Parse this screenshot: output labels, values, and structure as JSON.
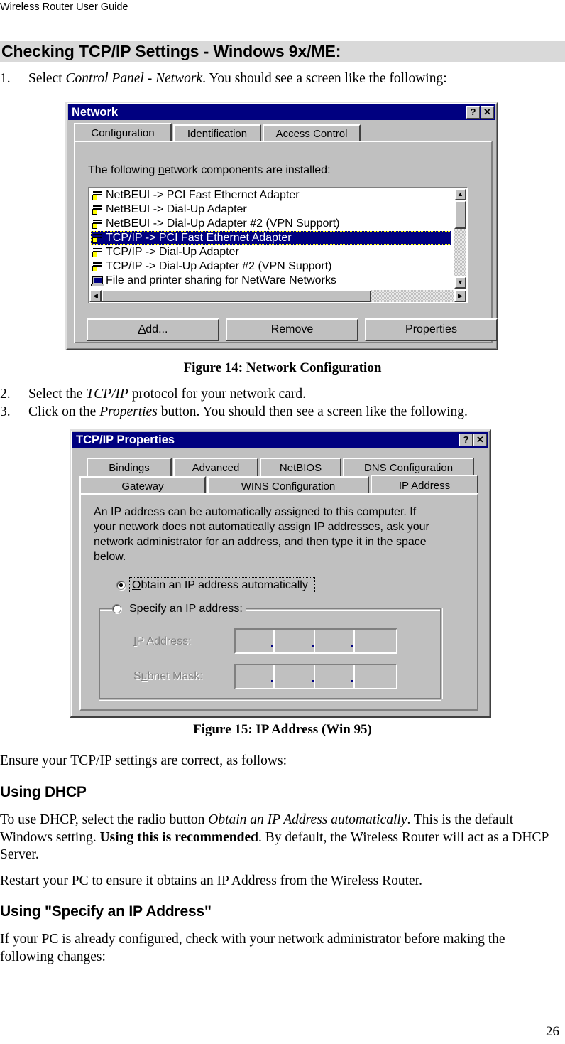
{
  "document": {
    "running_header": "Wireless Router User Guide",
    "page_number": "26",
    "heading1": "Checking TCP/IP Settings - Windows 9x/ME:",
    "steps": [
      {
        "num": "1.",
        "parts": [
          {
            "t": "Select ",
            "s": "n"
          },
          {
            "t": "Control Panel - Network",
            "s": "i"
          },
          {
            "t": ". You should see a screen like the following:",
            "s": "n"
          }
        ]
      },
      {
        "num": "2.",
        "parts": [
          {
            "t": "Select the ",
            "s": "n"
          },
          {
            "t": "TCP/IP",
            "s": "i"
          },
          {
            "t": " protocol for your network card.",
            "s": "n"
          }
        ]
      },
      {
        "num": "3.",
        "parts": [
          {
            "t": "Click on the ",
            "s": "n"
          },
          {
            "t": "Properties",
            "s": "i"
          },
          {
            "t": " button. You should then see a screen like the following.",
            "s": "n"
          }
        ]
      }
    ],
    "figure14_caption": "Figure 14: Network Configuration",
    "figure15_caption": "Figure 15: IP Address (Win 95)",
    "intro_para": "Ensure your TCP/IP settings are correct, as follows:",
    "heading_dhcp": "Using DHCP",
    "dhcp_para_parts": [
      {
        "t": "To use DHCP, select the radio button ",
        "s": "n"
      },
      {
        "t": "Obtain an IP Address automatically",
        "s": "i"
      },
      {
        "t": ". This is the default Windows setting. ",
        "s": "n"
      },
      {
        "t": "Using this is recommended",
        "s": "b"
      },
      {
        "t": ". By default, the Wireless Router will act as a DHCP Server.",
        "s": "n"
      }
    ],
    "restart_para": "Restart your PC to ensure it obtains an IP Address from the Wireless Router.",
    "heading_specify": "Using \"Specify an IP Address\"",
    "specify_para": "If your PC is already configured, check with your network administrator before making the following changes:"
  },
  "figure14": {
    "window_title": "Network",
    "titlebar_buttons": [
      {
        "name": "help-button",
        "glyph": "?"
      },
      {
        "name": "close-button",
        "glyph": "✕"
      }
    ],
    "tabs": [
      {
        "label": "Configuration",
        "active": true
      },
      {
        "label": "Identification",
        "active": false
      },
      {
        "label": "Access Control",
        "active": false
      }
    ],
    "list_caption_pre": "The following ",
    "list_caption_underlined": "n",
    "list_caption_post": "etwork components are installed:",
    "components": [
      {
        "label": "NetBEUI -> PCI Fast Ethernet Adapter",
        "icon": "protocol-icon",
        "selected": false
      },
      {
        "label": "NetBEUI -> Dial-Up Adapter",
        "icon": "protocol-icon",
        "selected": false
      },
      {
        "label": "NetBEUI -> Dial-Up Adapter #2 (VPN Support)",
        "icon": "protocol-icon",
        "selected": false
      },
      {
        "label": "TCP/IP -> PCI Fast Ethernet Adapter",
        "icon": "protocol-icon",
        "selected": true
      },
      {
        "label": "TCP/IP -> Dial-Up Adapter",
        "icon": "protocol-icon",
        "selected": false
      },
      {
        "label": "TCP/IP -> Dial-Up Adapter #2 (VPN Support)",
        "icon": "protocol-icon",
        "selected": false
      },
      {
        "label": "File and printer sharing for NetWare Networks",
        "icon": "computer-icon",
        "selected": false
      }
    ],
    "buttons": [
      {
        "name": "add-button",
        "pre": "A",
        "mid": "dd...",
        "label": "Add..."
      },
      {
        "name": "remove-button",
        "pre": "R",
        "mid": "emove",
        "label": "Remove"
      },
      {
        "name": "properties-button",
        "pre": "P",
        "mid": "roperties",
        "label": "Properties"
      }
    ]
  },
  "figure15": {
    "window_title": "TCP/IP Properties",
    "titlebar_buttons": [
      {
        "name": "help-button",
        "glyph": "?"
      },
      {
        "name": "close-button",
        "glyph": "✕"
      }
    ],
    "tabs_row1": [
      {
        "label": "Bindings"
      },
      {
        "label": "Advanced"
      },
      {
        "label": "NetBIOS"
      },
      {
        "label": "DNS Configuration"
      }
    ],
    "tabs_row2": [
      {
        "label": "Gateway",
        "active": false
      },
      {
        "label": "WINS Configuration",
        "active": false
      },
      {
        "label": "IP Address",
        "active": true
      }
    ],
    "description_lines": [
      "An IP address can be automatically assigned to this computer.  If",
      "your network does not automatically assign IP addresses, ask your",
      "network administrator for an address, and then type it in the space",
      "below."
    ],
    "radio_obtain": {
      "label": "Obtain an IP address automatically",
      "underline": "O",
      "selected": true
    },
    "radio_specify": {
      "label": "Specify an IP address:",
      "underline": "S",
      "selected": false
    },
    "fields": [
      {
        "label": "IP Address:",
        "underline": "I",
        "value": [
          "",
          "",
          "",
          ""
        ],
        "separator": "."
      },
      {
        "label": "Subnet Mask:",
        "underline": "u",
        "value": [
          "",
          "",
          "",
          ""
        ],
        "separator": "."
      }
    ]
  },
  "colors": {
    "heading_band": "#d9d9d9",
    "titlebar": "#000080",
    "dialog_face": "#c0c0c0",
    "selection": "#000080",
    "focus_outline": "#ffff00"
  }
}
